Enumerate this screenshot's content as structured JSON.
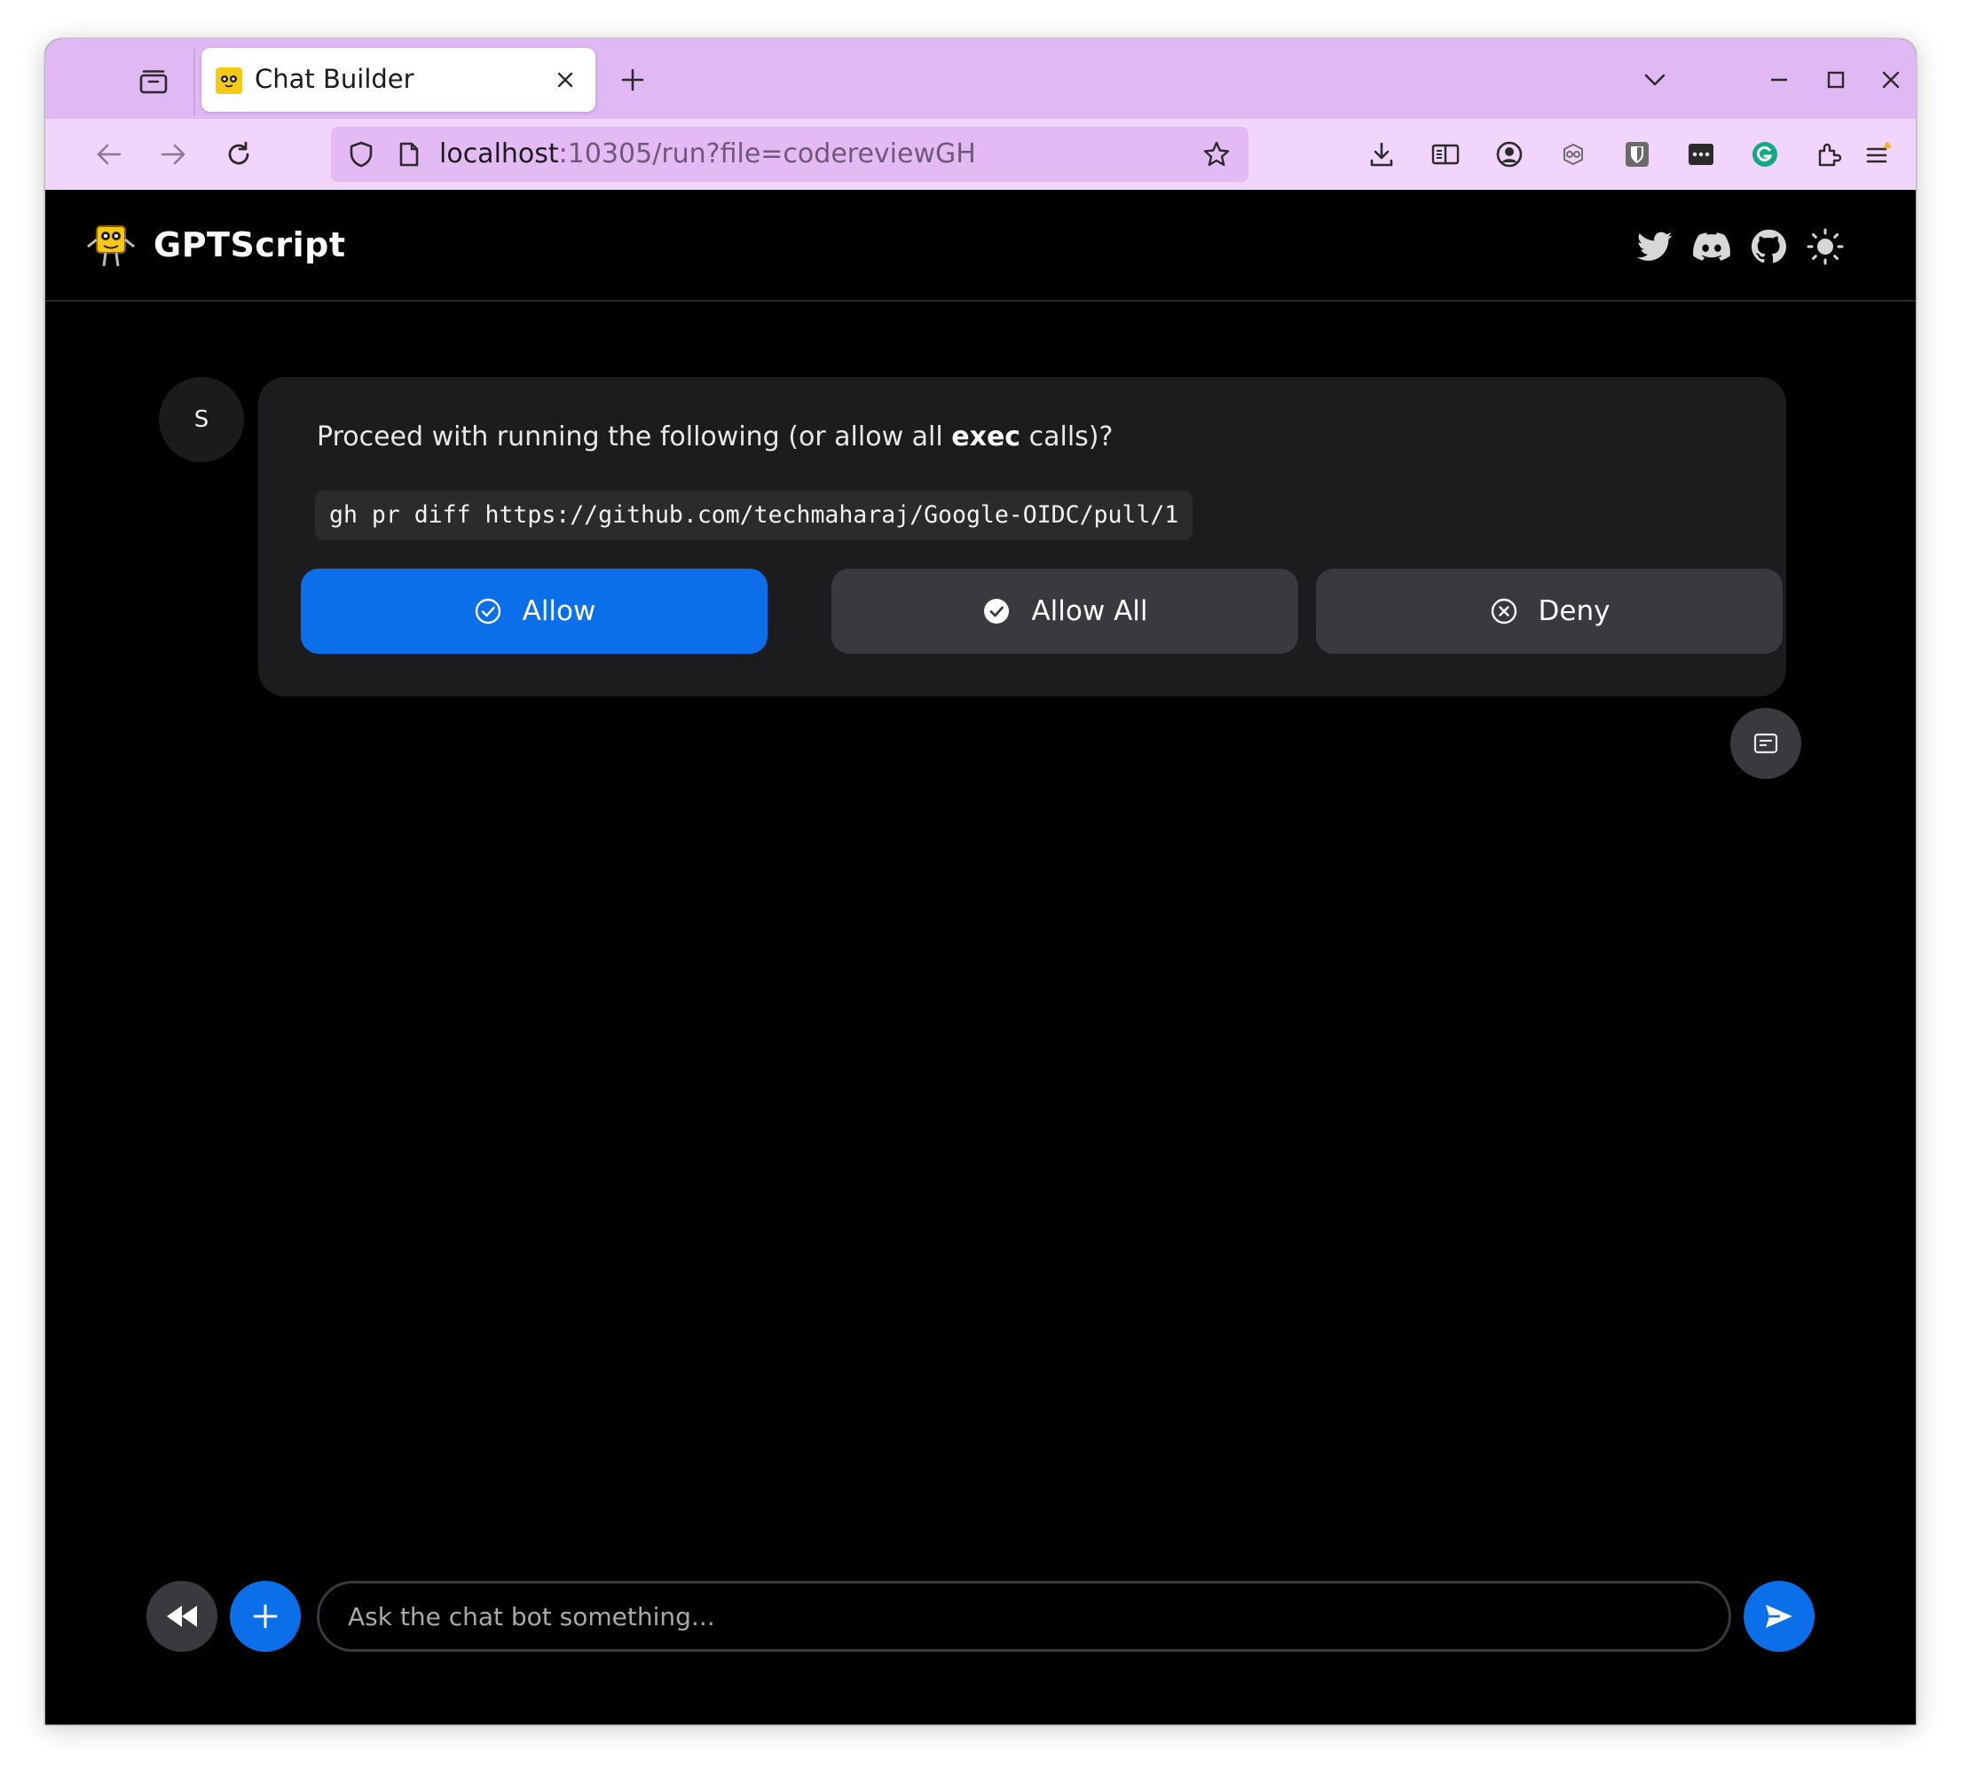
{
  "browser": {
    "tab": {
      "title": "Chat Builder",
      "favicon": "gptscript-logo-icon"
    },
    "url": {
      "host": "localhost",
      "rest": ":10305/run?file=codereviewGH"
    },
    "colors": {
      "tabstrip": "#e0b8f3",
      "toolbar": "#f2d5fb",
      "urlbar": "#e3baf4"
    },
    "toolbar_icons": [
      "back-icon",
      "forward-icon",
      "reload-icon",
      "download-icon",
      "reader-view-icon",
      "account-icon",
      "extension-icon",
      "bitwarden-icon",
      "password-icon",
      "grammarly-icon",
      "extensions-icon",
      "menu-icon"
    ]
  },
  "app": {
    "brand": "GPTScript",
    "social_icons": [
      "twitter-icon",
      "discord-icon",
      "github-icon",
      "theme-toggle-icon"
    ]
  },
  "message": {
    "avatar": "S",
    "prompt_before": "Proceed with running the following (or allow all ",
    "prompt_bold": "exec",
    "prompt_after": " calls)?",
    "command": "gh pr diff https://github.com/techmaharaj/Google-OIDC/pull/1",
    "buttons": {
      "allow": "Allow",
      "allow_all": "Allow All",
      "deny": "Deny"
    }
  },
  "composer": {
    "placeholder": "Ask the chat bot something..."
  },
  "colors": {
    "accent": "#0a6fe8",
    "page_bg": "#000000",
    "bubble_bg": "#1c1c1e",
    "secondary_button": "#3a3a3e"
  }
}
